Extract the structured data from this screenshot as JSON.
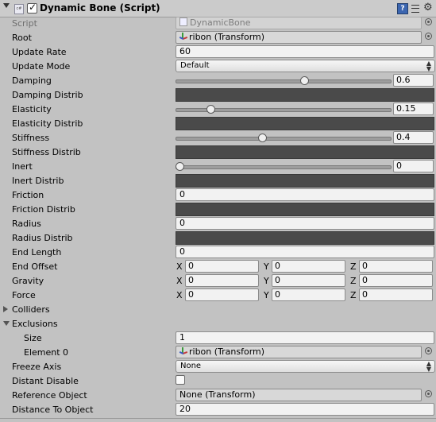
{
  "component": {
    "title": "Dynamic Bone (Script)",
    "icon": "cs-script-icon",
    "icon_text": "c#",
    "help": "?"
  },
  "rows": {
    "script": {
      "label": "Script",
      "value": "DynamicBone"
    },
    "root": {
      "label": "Root",
      "value": "ribon (Transform)"
    },
    "update_rate": {
      "label": "Update Rate",
      "value": "60"
    },
    "update_mode": {
      "label": "Update Mode",
      "value": "Default"
    },
    "damping": {
      "label": "Damping",
      "value": "0.6",
      "fraction": 0.6
    },
    "damping_distrib": {
      "label": "Damping Distrib"
    },
    "elasticity": {
      "label": "Elasticity",
      "value": "0.15",
      "fraction": 0.15
    },
    "elasticity_distrib": {
      "label": "Elasticity Distrib"
    },
    "stiffness": {
      "label": "Stiffness",
      "value": "0.4",
      "fraction": 0.4
    },
    "stiffness_distrib": {
      "label": "Stiffness Distrib"
    },
    "inert": {
      "label": "Inert",
      "value": "0",
      "fraction": 0
    },
    "inert_distrib": {
      "label": "Inert Distrib"
    },
    "friction": {
      "label": "Friction",
      "value": "0"
    },
    "friction_distrib": {
      "label": "Friction Distrib"
    },
    "radius": {
      "label": "Radius",
      "value": "0"
    },
    "radius_distrib": {
      "label": "Radius Distrib"
    },
    "end_length": {
      "label": "End Length",
      "value": "0"
    },
    "end_offset": {
      "label": "End Offset",
      "x": "0",
      "y": "0",
      "z": "0"
    },
    "gravity": {
      "label": "Gravity",
      "x": "0",
      "y": "0",
      "z": "0"
    },
    "force": {
      "label": "Force",
      "x": "0",
      "y": "0",
      "z": "0"
    },
    "colliders": {
      "label": "Colliders"
    },
    "exclusions": {
      "label": "Exclusions"
    },
    "size": {
      "label": "Size",
      "value": "1"
    },
    "element0": {
      "label": "Element 0",
      "value": "ribon (Transform)"
    },
    "freeze_axis": {
      "label": "Freeze Axis",
      "value": "None"
    },
    "distant_disable": {
      "label": "Distant Disable"
    },
    "reference_object": {
      "label": "Reference Object",
      "value": "None (Transform)"
    },
    "distance_to_object": {
      "label": "Distance To Object",
      "value": "20"
    }
  },
  "axis": {
    "x": "X",
    "y": "Y",
    "z": "Z"
  },
  "colors": {
    "panel": "#c2c2c2",
    "curve": "#4a4a4a",
    "field": "#f2f2f2"
  }
}
